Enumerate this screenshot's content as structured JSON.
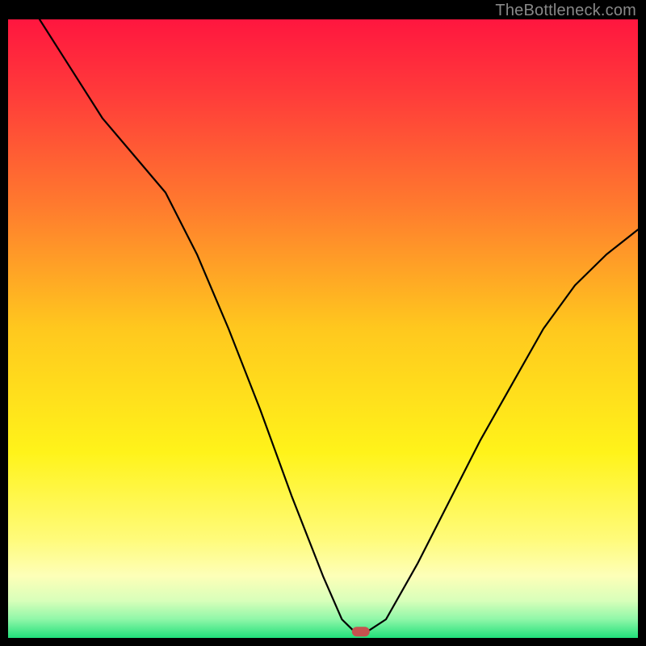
{
  "watermark": "TheBottleneck.com",
  "chart_data": {
    "type": "line",
    "title": "",
    "xlabel": "",
    "ylabel": "",
    "xlim": [
      0,
      100
    ],
    "ylim": [
      0,
      100
    ],
    "background_gradient": {
      "stops": [
        {
          "pos": 0.0,
          "color": "#ff163f"
        },
        {
          "pos": 0.12,
          "color": "#ff3b3a"
        },
        {
          "pos": 0.3,
          "color": "#ff7a2e"
        },
        {
          "pos": 0.5,
          "color": "#ffc81e"
        },
        {
          "pos": 0.7,
          "color": "#fff31a"
        },
        {
          "pos": 0.84,
          "color": "#fffb7a"
        },
        {
          "pos": 0.9,
          "color": "#fdffb8"
        },
        {
          "pos": 0.94,
          "color": "#d8ffba"
        },
        {
          "pos": 0.97,
          "color": "#8ff7a8"
        },
        {
          "pos": 1.0,
          "color": "#20e07a"
        }
      ]
    },
    "series": [
      {
        "name": "bottleneck-curve",
        "x": [
          5,
          10,
          15,
          20,
          25,
          30,
          35,
          40,
          45,
          50,
          53,
          55,
          57,
          60,
          65,
          70,
          75,
          80,
          85,
          90,
          95,
          100
        ],
        "y": [
          100,
          92,
          84,
          78,
          72,
          62,
          50,
          37,
          23,
          10,
          3,
          1,
          1,
          3,
          12,
          22,
          32,
          41,
          50,
          57,
          62,
          66
        ]
      }
    ],
    "marker": {
      "x": 56,
      "y": 1,
      "color": "#c6524f"
    }
  }
}
